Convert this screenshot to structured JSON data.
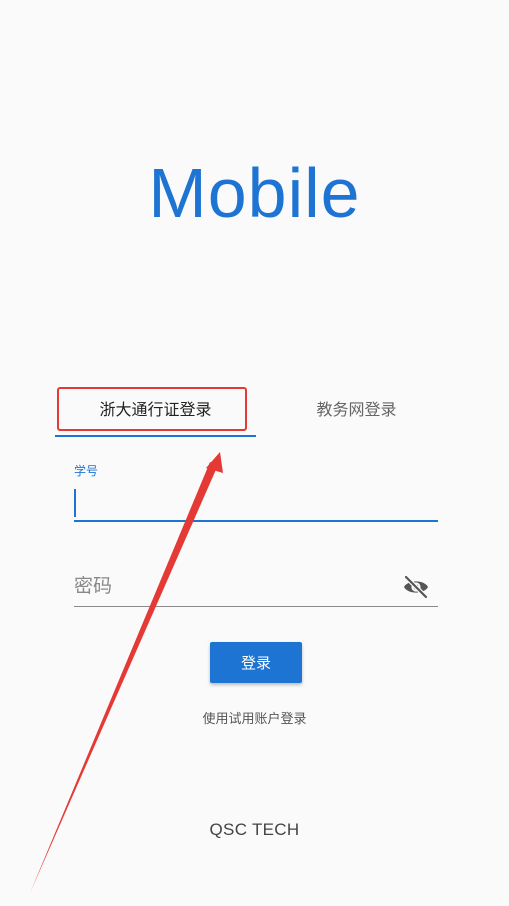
{
  "app": {
    "title": "Mobile"
  },
  "tabs": [
    {
      "label": "浙大通行证登录",
      "active": true
    },
    {
      "label": "教务网登录",
      "active": false
    }
  ],
  "form": {
    "student_id": {
      "label": "学号",
      "value": ""
    },
    "password": {
      "placeholder": "密码",
      "value": "",
      "toggle_icon": "eye-off-icon"
    },
    "login_label": "登录",
    "trial_label": "使用试用账户登录"
  },
  "footer": {
    "text": "QSC TECH"
  },
  "colors": {
    "accent": "#1e74d2",
    "annotation": "#e53935",
    "background": "#fafafa"
  }
}
